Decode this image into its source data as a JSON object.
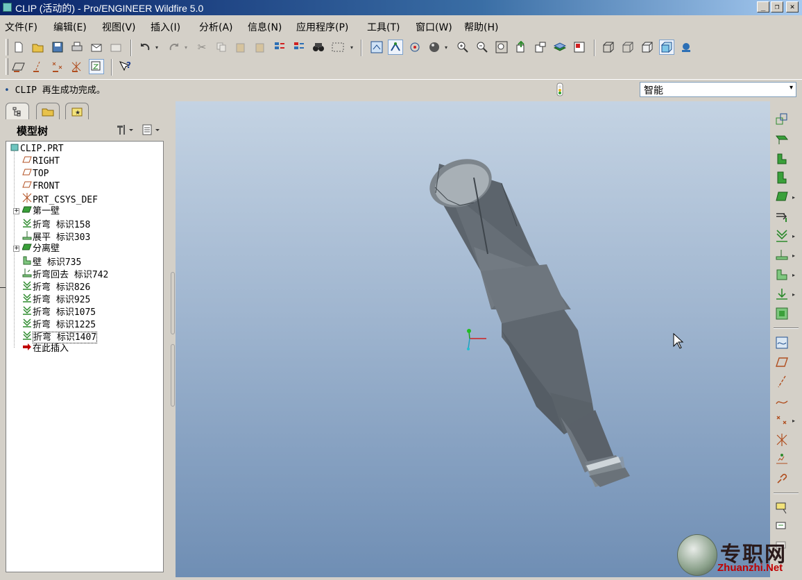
{
  "window": {
    "title": "CLIP (活动的) - Pro/ENGINEER Wildfire 5.0",
    "controls": [
      "_",
      "❐",
      "✕"
    ]
  },
  "menu": [
    "文件(F)",
    "编辑(E)",
    "视图(V)",
    "插入(I)",
    "分析(A)",
    "信息(N)",
    "应用程序(P)",
    "工具(T)",
    "窗口(W)",
    "帮助(H)"
  ],
  "message": {
    "bullet": "•",
    "text": "CLIP 再生成功完成。"
  },
  "filter": {
    "selected": "智能"
  },
  "navigator": {
    "title": "模型树",
    "tabs": [
      "model-tree",
      "folder-browser",
      "favorites"
    ]
  },
  "tree": [
    {
      "label": "CLIP.PRT",
      "icon": "part-icon",
      "level": 0
    },
    {
      "label": "RIGHT",
      "icon": "datum-plane-icon",
      "level": 1
    },
    {
      "label": "TOP",
      "icon": "datum-plane-icon",
      "level": 1
    },
    {
      "label": "FRONT",
      "icon": "datum-plane-icon",
      "level": 1
    },
    {
      "label": "PRT_CSYS_DEF",
      "icon": "csys-icon",
      "level": 1
    },
    {
      "label": "第一壁",
      "icon": "wall-icon",
      "level": 1,
      "expandable": true
    },
    {
      "label": "折弯 标识158",
      "icon": "bend-icon",
      "level": 1
    },
    {
      "label": "展平 标识303",
      "icon": "unbend-icon",
      "level": 1
    },
    {
      "label": "分离壁",
      "icon": "wall-icon",
      "level": 1,
      "expandable": true
    },
    {
      "label": "壁 标识735",
      "icon": "flat-wall-icon",
      "level": 1
    },
    {
      "label": "折弯回去 标识742",
      "icon": "bend-back-icon",
      "level": 1
    },
    {
      "label": "折弯 标识826",
      "icon": "bend-icon",
      "level": 1
    },
    {
      "label": "折弯 标识925",
      "icon": "bend-icon",
      "level": 1
    },
    {
      "label": "折弯 标识1075",
      "icon": "bend-icon",
      "level": 1
    },
    {
      "label": "折弯 标识1225",
      "icon": "bend-icon",
      "level": 1
    },
    {
      "label": "折弯 标识1407",
      "icon": "bend-icon",
      "level": 1,
      "selected": true
    },
    {
      "label": "在此插入",
      "icon": "insert-here-icon",
      "level": 1
    }
  ],
  "watermark": {
    "text": "专职网",
    "url": "Zhuanzhi.Net"
  }
}
